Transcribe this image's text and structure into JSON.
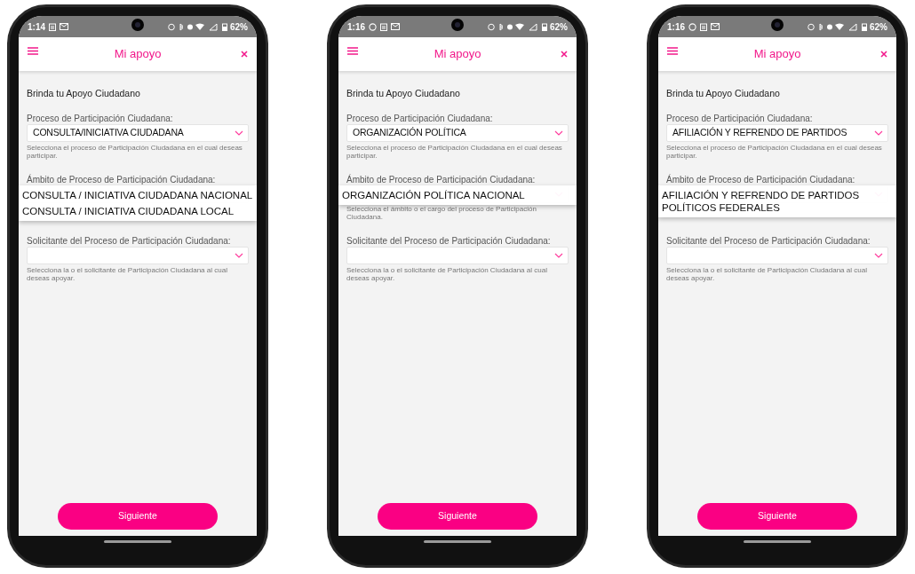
{
  "phones": [
    {
      "status_bar": {
        "time": "1:14",
        "chat_notification": false,
        "battery": "62%"
      },
      "app_bar": {
        "title": "Mi apoyo"
      },
      "heading": "Brinda tu Apoyo Ciudadano",
      "fields": [
        {
          "label": "Proceso de Participación Ciudadana:",
          "value": "CONSULTA/INICIATIVA CIUDADANA",
          "open": false,
          "hint": "Selecciona el proceso de Participación Ciudadana en el cual deseas participar."
        },
        {
          "label": "Ámbito de Proceso de Participación Ciudadana:",
          "open": true,
          "options": [
            "CONSULTA / INICIATIVA CIUDADANA NACIONAL",
            "CONSULTA / INICIATIVA CIUDADANA LOCAL"
          ]
        },
        {
          "label": "Solicitante del Proceso de Participación Ciudadana:",
          "open": false,
          "hint": "Selecciona la o el solicitante de Participación Ciudadana al cual deseas apoyar."
        }
      ],
      "button": "Siguiente"
    },
    {
      "status_bar": {
        "time": "1:16",
        "chat_notification": true,
        "battery": "62%"
      },
      "app_bar": {
        "title": "Mi apoyo"
      },
      "heading": "Brinda tu Apoyo Ciudadano",
      "fields": [
        {
          "label": "Proceso de Participación Ciudadana:",
          "value": "ORGANIZACIÓN POLÍTICA",
          "open": false,
          "hint": "Selecciona el proceso de Participación Ciudadana en el cual deseas participar."
        },
        {
          "label": "Ámbito de Proceso de Participación Ciudadana:",
          "open": true,
          "options": [
            "ORGANIZACIÓN POLÍTICA NACIONAL"
          ],
          "hint": "Selecciona el ámbito o el cargo del proceso de Participación Ciudadana."
        },
        {
          "label": "Solicitante del Proceso de Participación Ciudadana:",
          "open": false,
          "hint": "Selecciona la o el solicitante de Participación Ciudadana al cual deseas apoyar."
        }
      ],
      "button": "Siguiente"
    },
    {
      "status_bar": {
        "time": "1:16",
        "chat_notification": true,
        "battery": "62%"
      },
      "app_bar": {
        "title": "Mi apoyo"
      },
      "heading": "Brinda tu Apoyo Ciudadano",
      "fields": [
        {
          "label": "Proceso de Participación Ciudadana:",
          "value": "AFILIACIÓN Y REFRENDO DE PARTIDOS",
          "open": false,
          "hint": "Selecciona el proceso de Participación Ciudadana en el cual deseas participar."
        },
        {
          "label": "Ámbito de Proceso de Participación Ciudadana:",
          "open": true,
          "options": [
            "AFILIACIÓN Y REFRENDO DE PARTIDOS POLÍTICOS FEDERALES"
          ]
        },
        {
          "label": "Solicitante del Proceso de Participación Ciudadana:",
          "open": false,
          "hint": "Selecciona la o el solicitante de Participación Ciudadana al cual deseas apoyar."
        }
      ],
      "button": "Siguiente"
    }
  ]
}
